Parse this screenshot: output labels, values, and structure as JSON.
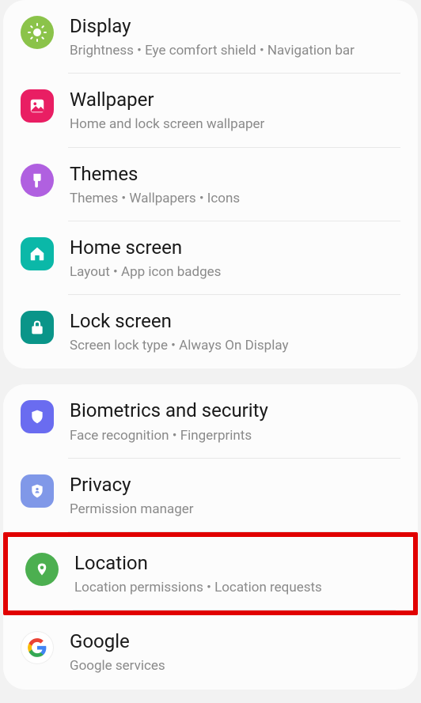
{
  "groups": [
    {
      "items": [
        {
          "key": "display",
          "title": "Display",
          "subtitle": "Brightness  •  Eye comfort shield  •  Navigation bar",
          "icon": "sun-icon",
          "iconClass": "bg-lime icon-round"
        },
        {
          "key": "wallpaper",
          "title": "Wallpaper",
          "subtitle": "Home and lock screen wallpaper",
          "icon": "picture-icon",
          "iconClass": "bg-pink"
        },
        {
          "key": "themes",
          "title": "Themes",
          "subtitle": "Themes  •  Wallpapers  •  Icons",
          "icon": "brush-icon",
          "iconClass": "bg-purple icon-round"
        },
        {
          "key": "homescreen",
          "title": "Home screen",
          "subtitle": "Layout  •  App icon badges",
          "icon": "home-icon",
          "iconClass": "bg-teal"
        },
        {
          "key": "lockscreen",
          "title": "Lock screen",
          "subtitle": "Screen lock type  •  Always On Display",
          "icon": "lock-icon",
          "iconClass": "bg-tealdark"
        }
      ]
    },
    {
      "items": [
        {
          "key": "biometrics",
          "title": "Biometrics and security",
          "subtitle": "Face recognition  •  Fingerprints",
          "icon": "shield-icon",
          "iconClass": "bg-indigo"
        },
        {
          "key": "privacy",
          "title": "Privacy",
          "subtitle": "Permission manager",
          "icon": "privacy-icon",
          "iconClass": "bg-blue"
        },
        {
          "key": "location",
          "title": "Location",
          "subtitle": "Location permissions  •  Location requests",
          "icon": "location-icon",
          "iconClass": "bg-green icon-round",
          "highlighted": true
        },
        {
          "key": "google",
          "title": "Google",
          "subtitle": "Google services",
          "icon": "google-icon",
          "iconClass": "bg-white icon-round"
        }
      ]
    }
  ]
}
